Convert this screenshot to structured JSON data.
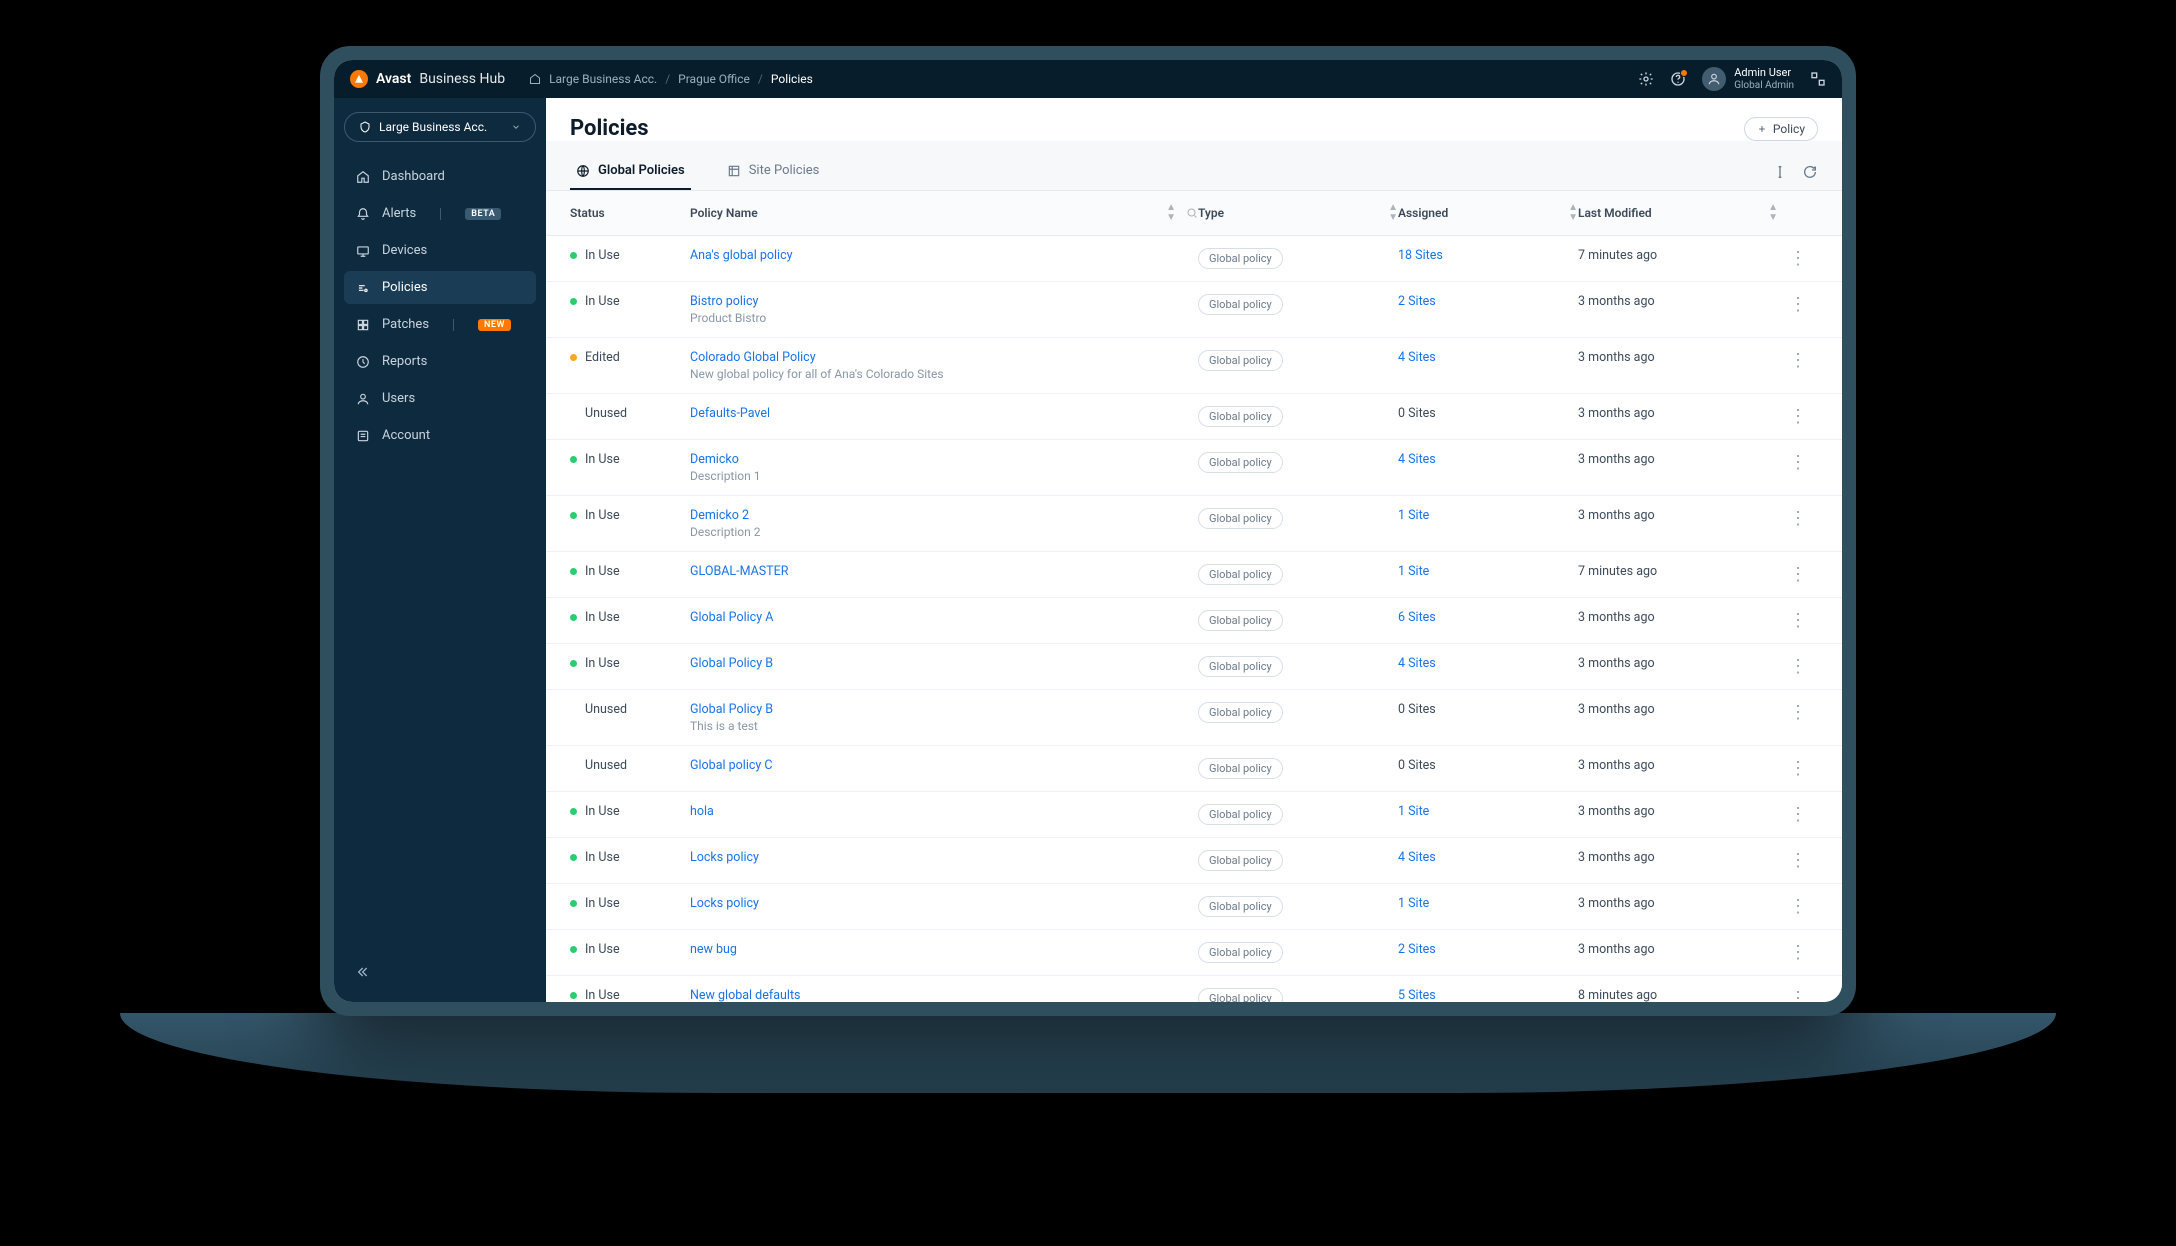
{
  "brand": {
    "name_bold": "Avast",
    "name_rest": "Business Hub"
  },
  "breadcrumb": [
    "Large Business Acc.",
    "Prague Office",
    "Policies"
  ],
  "user": {
    "name": "Admin User",
    "role": "Global Admin"
  },
  "sidebar": {
    "account_selector": "Large Business Acc.",
    "items": [
      {
        "icon": "dashboard",
        "label": "Dashboard",
        "badge": null,
        "active": false
      },
      {
        "icon": "alerts",
        "label": "Alerts",
        "badge": "BETA",
        "badge_style": "neutral",
        "active": false
      },
      {
        "icon": "devices",
        "label": "Devices",
        "badge": null,
        "active": false
      },
      {
        "icon": "policies",
        "label": "Policies",
        "badge": null,
        "active": true
      },
      {
        "icon": "patches",
        "label": "Patches",
        "badge": "NEW",
        "badge_style": "orange",
        "active": false
      },
      {
        "icon": "reports",
        "label": "Reports",
        "badge": null,
        "active": false
      },
      {
        "icon": "users",
        "label": "Users",
        "badge": null,
        "active": false
      },
      {
        "icon": "account",
        "label": "Account",
        "badge": null,
        "active": false
      }
    ]
  },
  "page": {
    "title": "Policies",
    "add_button": "Policy",
    "tabs": [
      {
        "label": "Global Policies",
        "active": true
      },
      {
        "label": "Site Policies",
        "active": false
      }
    ]
  },
  "table": {
    "columns": [
      "Status",
      "Policy Name",
      "Type",
      "Assigned",
      "Last Modified"
    ],
    "rows": [
      {
        "status": "In Use",
        "status_kind": "inuse",
        "name": "Ana's global policy",
        "desc": "",
        "type": "Global policy",
        "assigned": "18 Sites",
        "assigned_link": true,
        "modified": "7 minutes ago"
      },
      {
        "status": "In Use",
        "status_kind": "inuse",
        "name": "Bistro policy",
        "desc": "Product Bistro",
        "type": "Global policy",
        "assigned": "2 Sites",
        "assigned_link": true,
        "modified": "3 months ago"
      },
      {
        "status": "Edited",
        "status_kind": "edited",
        "name": "Colorado Global Policy",
        "desc": "New global policy for all of Ana's Colorado Sites",
        "type": "Global policy",
        "assigned": "4 Sites",
        "assigned_link": true,
        "modified": "3 months ago"
      },
      {
        "status": "Unused",
        "status_kind": "unused",
        "name": "Defaults-Pavel",
        "desc": "",
        "type": "Global policy",
        "assigned": "0 Sites",
        "assigned_link": false,
        "modified": "3 months ago"
      },
      {
        "status": "In Use",
        "status_kind": "inuse",
        "name": "Demicko",
        "desc": "Description 1",
        "type": "Global policy",
        "assigned": "4 Sites",
        "assigned_link": true,
        "modified": "3 months ago"
      },
      {
        "status": "In Use",
        "status_kind": "inuse",
        "name": "Demicko 2",
        "desc": "Description 2",
        "type": "Global policy",
        "assigned": "1 Site",
        "assigned_link": true,
        "modified": "3 months ago"
      },
      {
        "status": "In Use",
        "status_kind": "inuse",
        "name": "GLOBAL-MASTER",
        "desc": "",
        "type": "Global policy",
        "assigned": "1 Site",
        "assigned_link": true,
        "modified": "7 minutes ago"
      },
      {
        "status": "In Use",
        "status_kind": "inuse",
        "name": "Global Policy A",
        "desc": "",
        "type": "Global policy",
        "assigned": "6 Sites",
        "assigned_link": true,
        "modified": "3 months ago"
      },
      {
        "status": "In Use",
        "status_kind": "inuse",
        "name": "Global Policy B",
        "desc": "",
        "type": "Global policy",
        "assigned": "4 Sites",
        "assigned_link": true,
        "modified": "3 months ago"
      },
      {
        "status": "Unused",
        "status_kind": "unused",
        "name": "Global Policy B",
        "desc": "This is a test",
        "type": "Global policy",
        "assigned": "0 Sites",
        "assigned_link": false,
        "modified": "3 months ago"
      },
      {
        "status": "Unused",
        "status_kind": "unused",
        "name": "Global policy C",
        "desc": "",
        "type": "Global policy",
        "assigned": "0 Sites",
        "assigned_link": false,
        "modified": "3 months ago"
      },
      {
        "status": "In Use",
        "status_kind": "inuse",
        "name": "hola",
        "desc": "",
        "type": "Global policy",
        "assigned": "1 Site",
        "assigned_link": true,
        "modified": "3 months ago"
      },
      {
        "status": "In Use",
        "status_kind": "inuse",
        "name": "Locks policy",
        "desc": "",
        "type": "Global policy",
        "assigned": "4 Sites",
        "assigned_link": true,
        "modified": "3 months ago"
      },
      {
        "status": "In Use",
        "status_kind": "inuse",
        "name": "Locks policy",
        "desc": "",
        "type": "Global policy",
        "assigned": "1 Site",
        "assigned_link": true,
        "modified": "3 months ago"
      },
      {
        "status": "In Use",
        "status_kind": "inuse",
        "name": "new bug",
        "desc": "",
        "type": "Global policy",
        "assigned": "2 Sites",
        "assigned_link": true,
        "modified": "3 months ago"
      },
      {
        "status": "In Use",
        "status_kind": "inuse",
        "name": "New global defaults",
        "desc": "",
        "type": "Global policy",
        "assigned": "5 Sites",
        "assigned_link": true,
        "modified": "8 minutes ago"
      }
    ]
  }
}
